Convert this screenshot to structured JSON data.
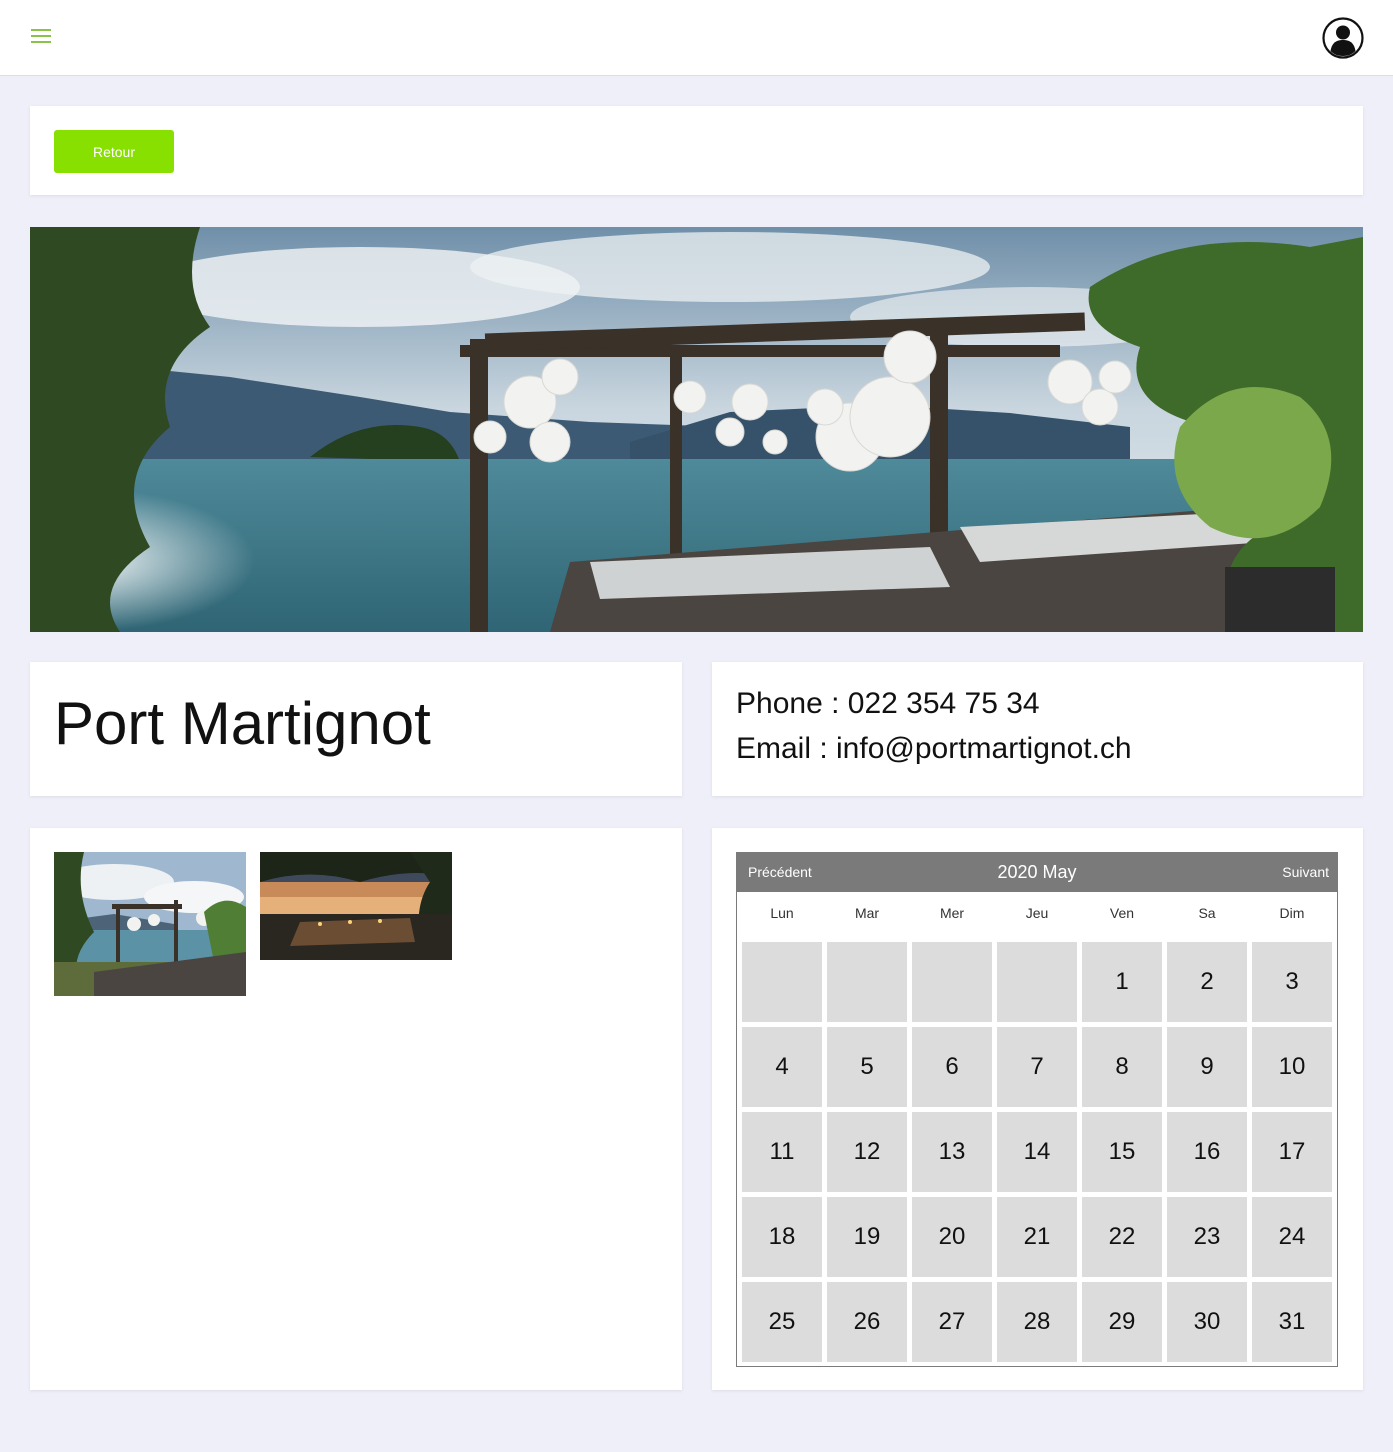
{
  "header": {
    "menu_icon": "hamburger-menu-icon",
    "account_icon": "user-avatar-icon",
    "accent_color": "#8bc34a"
  },
  "actions": {
    "back_label": "Retour",
    "back_color": "#88e000"
  },
  "venue": {
    "name": "Port Martignot",
    "phone_line": "Phone : 022 354 75 34",
    "email_line": "Email : info@portmartignot.ch"
  },
  "calendar": {
    "prev_label": "Précédent",
    "next_label": "Suivant",
    "title": "2020 May",
    "weekdays": [
      "Lun",
      "Mar",
      "Mer",
      "Jeu",
      "Ven",
      "Sa",
      "Dim"
    ],
    "days": [
      "",
      "",
      "",
      "",
      "1",
      "2",
      "3",
      "4",
      "5",
      "6",
      "7",
      "8",
      "9",
      "10",
      "11",
      "12",
      "13",
      "14",
      "15",
      "16",
      "17",
      "18",
      "19",
      "20",
      "21",
      "22",
      "23",
      "24",
      "25",
      "26",
      "27",
      "28",
      "29",
      "30",
      "31"
    ],
    "header_color": "#7a7a7a",
    "cell_color": "#dcdcdc"
  }
}
